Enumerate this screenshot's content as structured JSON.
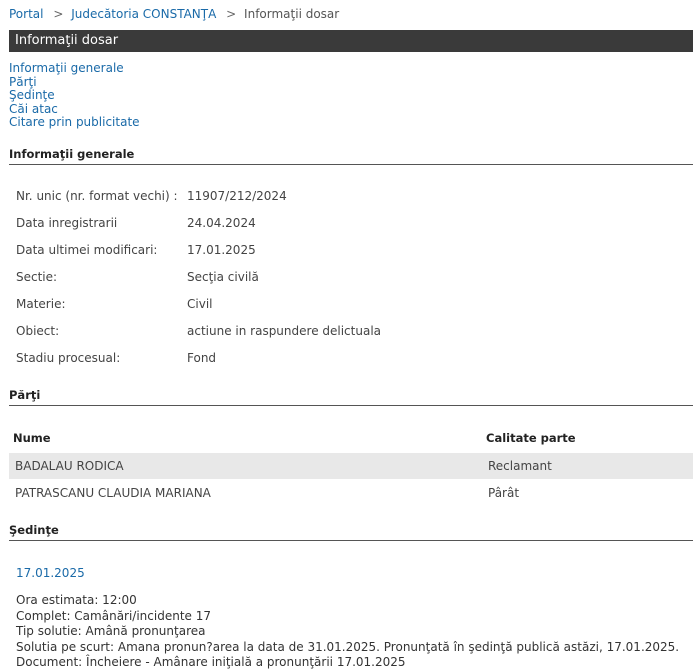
{
  "breadcrumb": {
    "portal": "Portal",
    "court": "Judecătoria CONSTANŢA",
    "current": "Informaţii dosar",
    "separator": ">"
  },
  "page_title": "Informaţii dosar",
  "toc": [
    "Informaţii generale",
    "Părţi",
    "Şedinţe",
    "Căi atac",
    "Citare prin publicitate"
  ],
  "general": {
    "heading": "Informaţii generale",
    "rows": [
      {
        "label": "Nr. unic (nr. format vechi) :",
        "value": "11907/212/2024"
      },
      {
        "label": "Data inregistrarii",
        "value": "24.04.2024"
      },
      {
        "label": "Data ultimei modificari:",
        "value": "17.01.2025"
      },
      {
        "label": "Sectie:",
        "value": "Secţia civilă"
      },
      {
        "label": "Materie:",
        "value": "Civil"
      },
      {
        "label": "Obiect:",
        "value": "actiune in raspundere delictuala"
      },
      {
        "label": "Stadiu procesual:",
        "value": "Fond"
      }
    ]
  },
  "parties": {
    "heading": "Părţi",
    "columns": [
      "Nume",
      "Calitate parte"
    ],
    "rows": [
      {
        "name": "BADALAU RODICA",
        "role": "Reclamant"
      },
      {
        "name": "PATRASCANU CLAUDIA MARIANA",
        "role": "Pârât"
      }
    ]
  },
  "sessions": {
    "heading": "Şedinţe",
    "date": "17.01.2025",
    "lines": [
      "Ora estimata: 12:00",
      "Complet: Camânări/incidente 17",
      "Tip solutie: Amână pronunţarea",
      "Solutia pe scurt: Amana pronun?area la data de 31.01.2025. Pronunţată în şedinţă publică astăzi, 17.01.2025.",
      "Document: Încheiere - Amânare iniţială a pronunţării    17.01.2025"
    ]
  }
}
